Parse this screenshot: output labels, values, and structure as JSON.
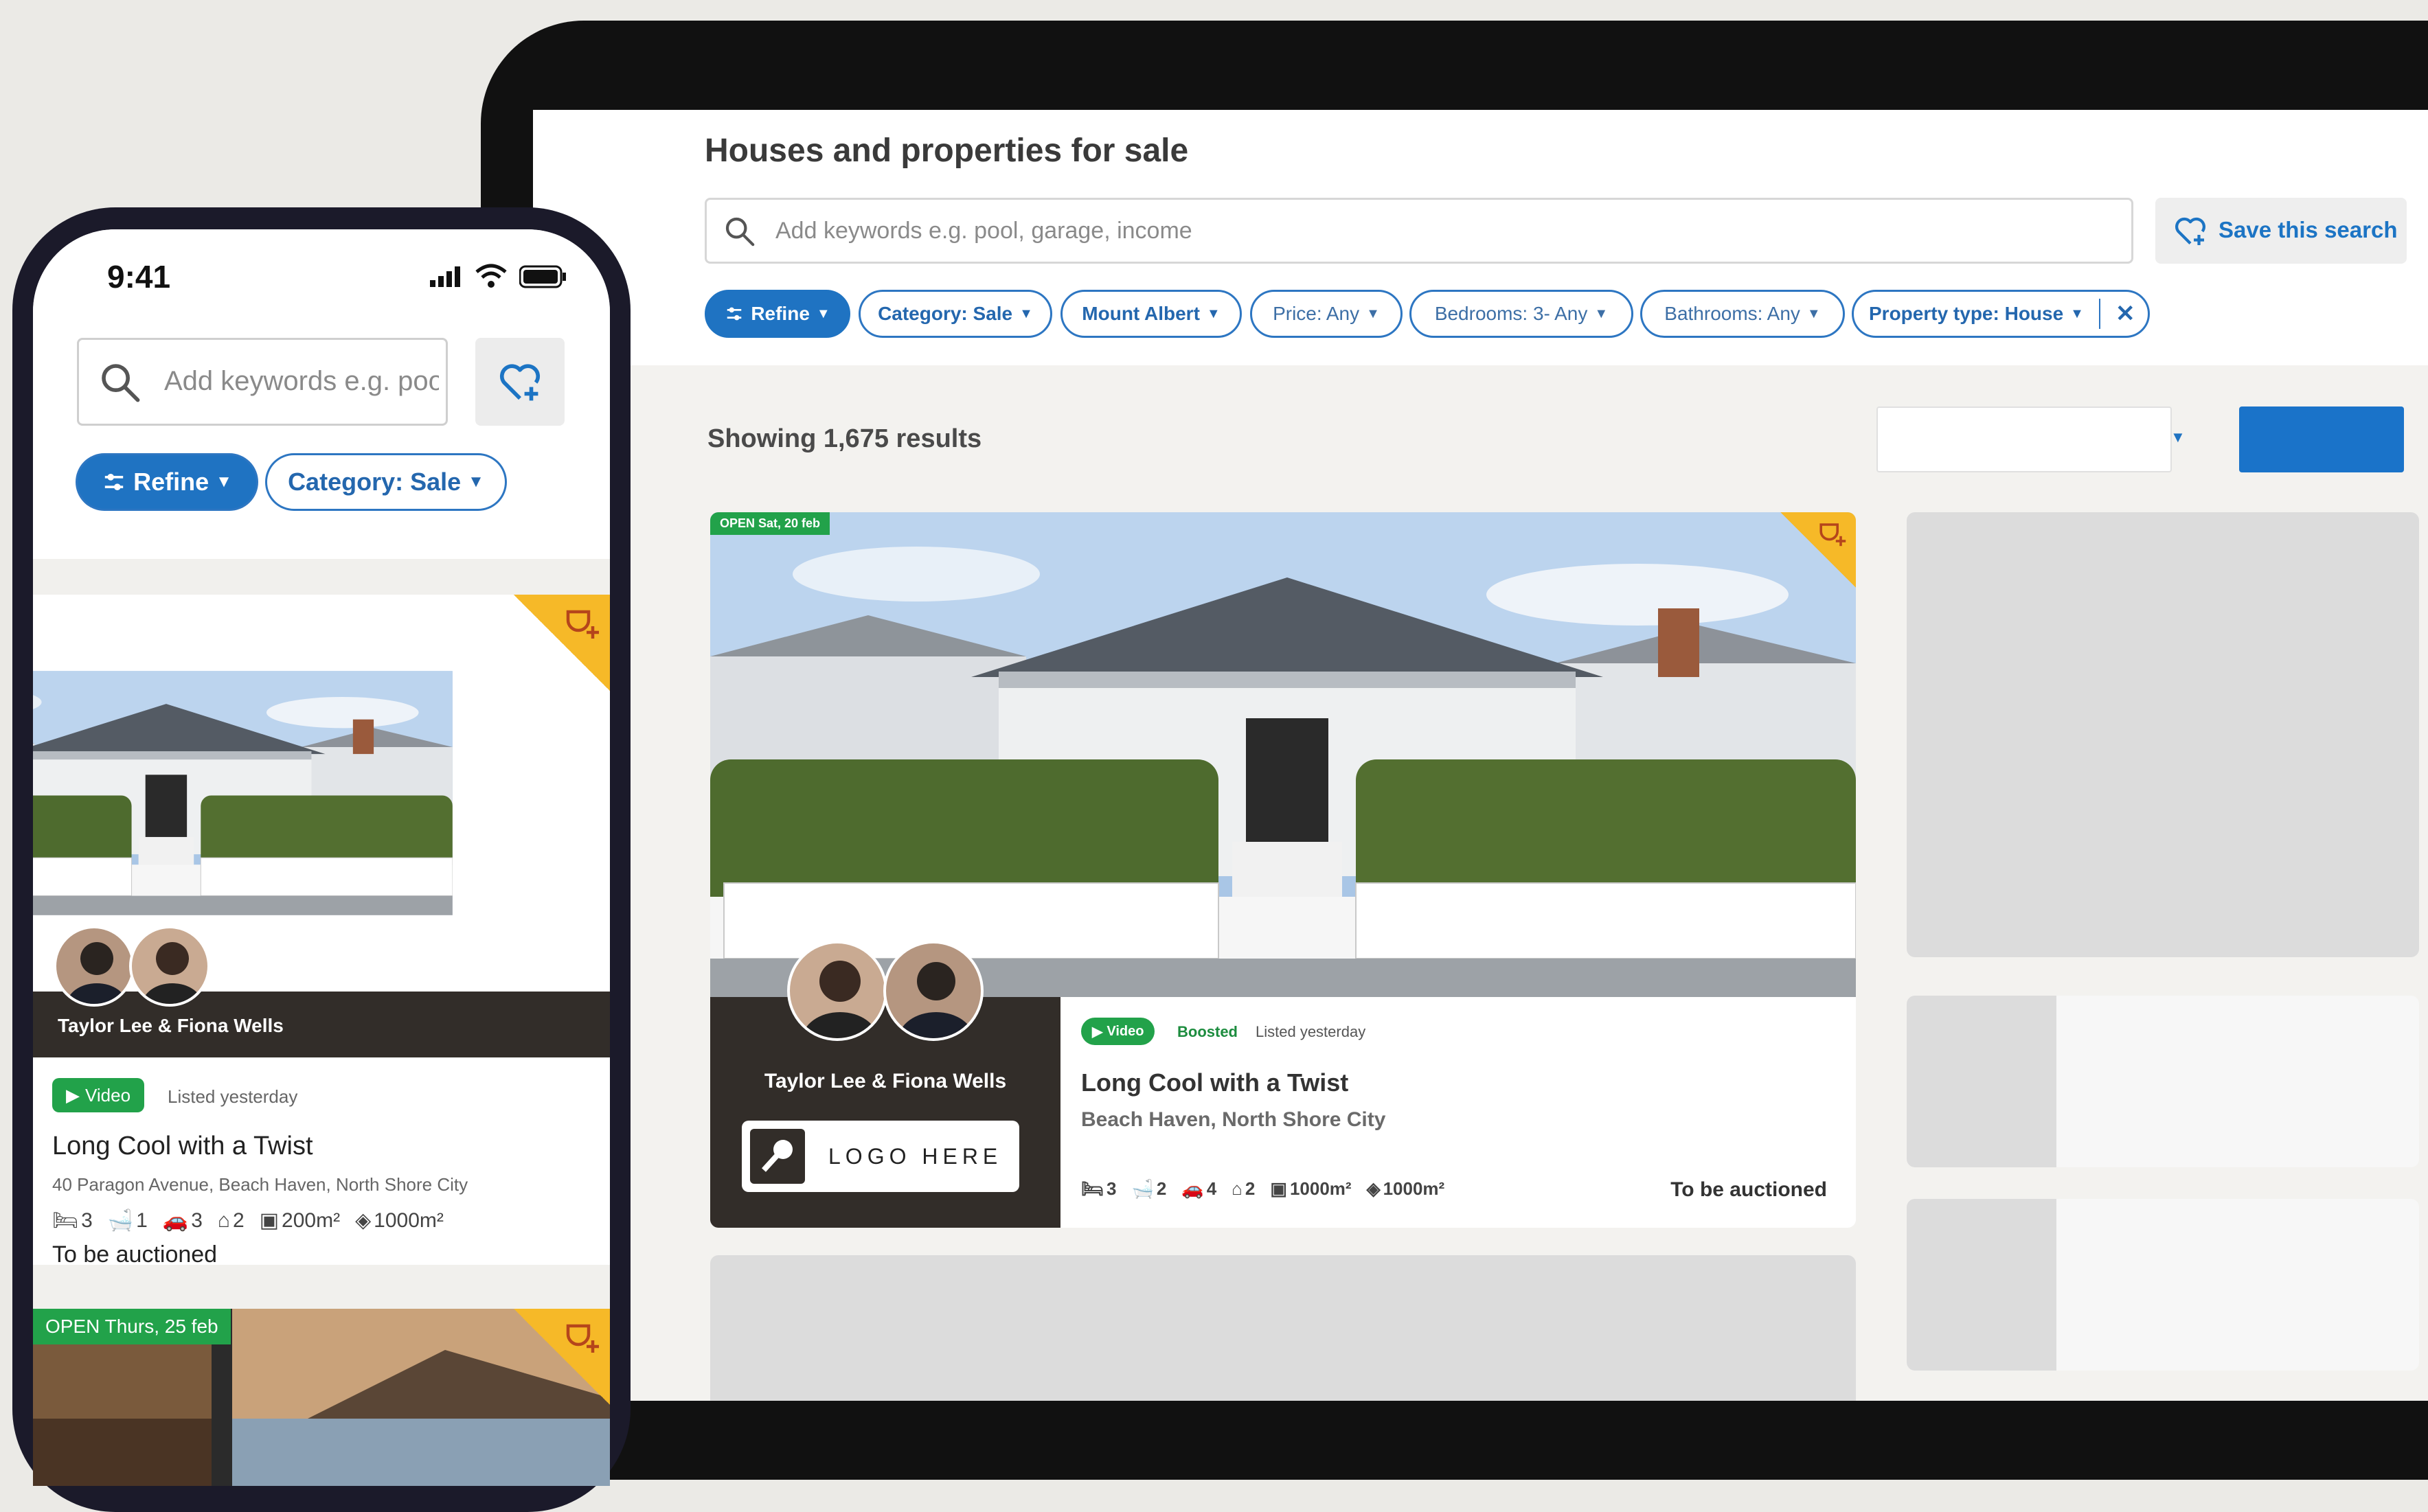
{
  "colors": {
    "brand_blue": "#1f73c2",
    "green": "#22a24a",
    "accent_yellow": "#f6b928",
    "agent_panel": "#322d29"
  },
  "tablet": {
    "page_title": "Houses and properties for sale",
    "search_placeholder": "Add keywords e.g. pool, garage, income",
    "save_search_label": "Save this search",
    "filters": [
      "Refine",
      "Category: Sale",
      "Mount Albert",
      "Price: Any",
      "Bedrooms: 3- Any",
      "Bathrooms: Any",
      "Property type: House"
    ],
    "results_text": "Showing 1,675 results",
    "listing": {
      "open_badge": "OPEN Sat, 20 feb",
      "agents": "Taylor Lee & Fiona Wells",
      "logo_text": "LOGO HERE",
      "video_label": "Video",
      "boosted_label": "Boosted",
      "listed": "Listed yesterday",
      "title": "Long Cool with a Twist",
      "location": "Beach Haven, North Shore City",
      "features": {
        "bedrooms": "3",
        "bathrooms": "2",
        "parking": "4",
        "garage": "2",
        "floor_area": "1000m²",
        "land_area": "1000m²"
      },
      "sale_method": "To be auctioned"
    }
  },
  "phone": {
    "time": "9:41",
    "search_placeholder": "Add keywords e.g. pool, garage, income",
    "filters": [
      "Refine",
      "Category: Sale"
    ],
    "listing": {
      "agents": "Taylor Lee & Fiona Wells",
      "video_label": "Video",
      "listed": "Listed yesterday",
      "title": "Long Cool with a Twist",
      "address": "40 Paragon Avenue, Beach Haven, North Shore City",
      "features": {
        "bedrooms": "3",
        "bathrooms": "1",
        "parking": "3",
        "garage": "2",
        "floor_area": "200m²",
        "land_area": "1000m²"
      },
      "sale_method": "To be auctioned"
    },
    "listing2": {
      "open_badge": "OPEN Thurs, 25 feb"
    }
  }
}
